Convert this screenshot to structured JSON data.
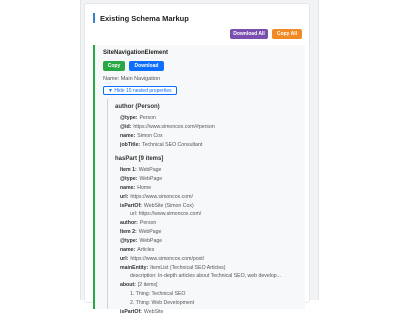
{
  "header": {
    "title": "Existing Schema Markup",
    "download_all": "Download All",
    "copy_all": "Copy All"
  },
  "element": {
    "type_name": "SiteNavigationElement",
    "copy_label": "Copy",
    "download_label": "Download",
    "name_line": "Name: Main Navigation",
    "toggle_label": "▼ Hide 10 nested properties"
  },
  "author": {
    "heading": "author (Person)",
    "props": [
      {
        "key": "@type:",
        "val": "Person"
      },
      {
        "key": "@id:",
        "val": "https://www.simoncox.com/#person"
      },
      {
        "key": "name:",
        "val": "Simon Cox"
      },
      {
        "key": "jobTitle:",
        "val": "Technical SEO Consultant"
      }
    ]
  },
  "haspart": {
    "heading": "hasPart [9 items]",
    "lines": [
      {
        "key": "Item 1:",
        "val": "WebPage"
      },
      {
        "key": "@type:",
        "val": "WebPage"
      },
      {
        "key": "name:",
        "val": "Home"
      },
      {
        "key": "url:",
        "val": "https://www.simoncox.com/"
      },
      {
        "key": "isPartOf:",
        "val": "WebSite (Simon Cox)"
      },
      {
        "key": "",
        "val": "url: https://www.simoncox.com/"
      },
      {
        "key": "author:",
        "val": "Person"
      },
      {
        "key": "Item 2:",
        "val": "WebPage"
      },
      {
        "key": "@type:",
        "val": "WebPage"
      },
      {
        "key": "name:",
        "val": "Articles"
      },
      {
        "key": "url:",
        "val": "https://www.simoncox.com/post/"
      },
      {
        "key": "mainEntity:",
        "val": "ItemList (Technical SEO Articles)"
      },
      {
        "key": "",
        "val": "description: In-depth articles about Technical SEO, web develop..."
      },
      {
        "key": "about:",
        "val": "[2 items]"
      },
      {
        "key": "",
        "val": "1. Thing: Technical SEO"
      },
      {
        "key": "",
        "val": "2. Thing: Web Development"
      },
      {
        "key": "isPartOf:",
        "val": "WebSite"
      }
    ]
  }
}
